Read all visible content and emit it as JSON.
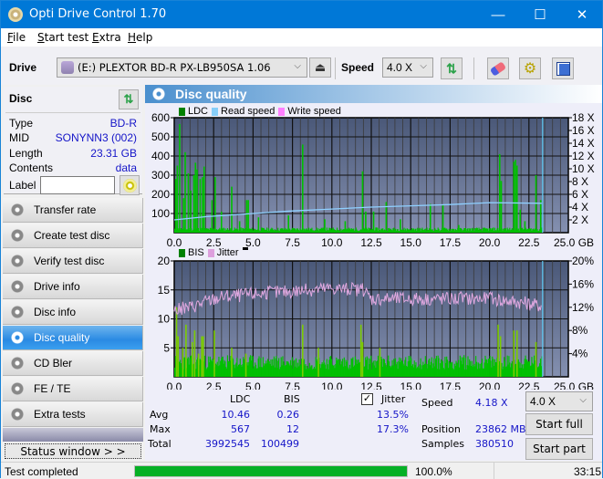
{
  "window": {
    "title": "Opti Drive Control 1.70",
    "controls": {
      "minimize": "—",
      "maximize": "☐",
      "close": "✕"
    }
  },
  "menu": [
    {
      "label": "File",
      "accel": "F",
      "rest": "ile"
    },
    {
      "label": "Start test",
      "accel": "S",
      "rest": "tart test"
    },
    {
      "label": "Extra",
      "accel": "E",
      "rest": "xtra"
    },
    {
      "label": "Help",
      "accel": "H",
      "rest": "elp"
    }
  ],
  "toolbar": {
    "drive_label": "Drive",
    "drive_value": "(E:)  PLEXTOR BD-R  PX-LB950SA 1.06",
    "speed_label": "Speed",
    "speed_value": "4.0 X",
    "icons": [
      "drive-icon",
      "eject-icon",
      "refresh-icon",
      "erase-icon",
      "settings-icon",
      "save-icon"
    ]
  },
  "disc": {
    "header": "Disc",
    "rows": [
      {
        "key": "Type",
        "value": "BD-R"
      },
      {
        "key": "MID",
        "value": "SONYNN3 (002)"
      },
      {
        "key": "Length",
        "value": "23.31 GB"
      },
      {
        "key": "Contents",
        "value": "data"
      }
    ],
    "label_key": "Label",
    "label_value": ""
  },
  "nav": [
    {
      "label": "Transfer rate",
      "active": false
    },
    {
      "label": "Create test disc",
      "active": false
    },
    {
      "label": "Verify test disc",
      "active": false
    },
    {
      "label": "Drive info",
      "active": false
    },
    {
      "label": "Disc info",
      "active": false
    },
    {
      "label": "Disc quality",
      "active": true
    },
    {
      "label": "CD Bler",
      "active": false
    },
    {
      "label": "FE / TE",
      "active": false
    },
    {
      "label": "Extra tests",
      "active": false
    }
  ],
  "status_window_label": "Status window > >",
  "panel": {
    "title": "Disc quality",
    "legend_top": [
      {
        "label": "LDC",
        "color": "#008000"
      },
      {
        "label": "Read speed",
        "color": "#87cefa"
      },
      {
        "label": "Write speed",
        "color": "#ff80ff"
      }
    ],
    "legend_bottom": [
      {
        "label": "BIS",
        "color": "#008000"
      },
      {
        "label": "Jitter",
        "color": "#dda0dd"
      }
    ]
  },
  "chart_data": [
    {
      "type": "bar",
      "title": "LDC / Read speed",
      "xlabel": "GB",
      "xlim": [
        0,
        25
      ],
      "ylim_left": [
        0,
        600
      ],
      "ylim_right": [
        0,
        18
      ],
      "x_ticks": [
        "0.0",
        "2.5",
        "5.0",
        "7.5",
        "10.0",
        "12.5",
        "15.0",
        "17.5",
        "20.0",
        "22.5",
        "25.0 GB"
      ],
      "y_left_ticks": [
        "100",
        "200",
        "300",
        "400",
        "500",
        "600"
      ],
      "y_right_ticks": [
        "2 X",
        "4 X",
        "6 X",
        "8 X",
        "10 X",
        "12 X",
        "14 X",
        "16 X",
        "18 X"
      ],
      "grid": true,
      "data_end_gb": 23.31,
      "ldc_spikes": [
        [
          0.05,
          280
        ],
        [
          0.15,
          350
        ],
        [
          0.3,
          567
        ],
        [
          0.55,
          180
        ],
        [
          0.65,
          420
        ],
        [
          0.85,
          310
        ],
        [
          1.0,
          220
        ],
        [
          1.2,
          300
        ],
        [
          1.3,
          365
        ],
        [
          1.4,
          330
        ],
        [
          1.6,
          280
        ],
        [
          1.75,
          290
        ],
        [
          1.85,
          345
        ],
        [
          2.35,
          170
        ],
        [
          2.55,
          290
        ],
        [
          2.95,
          110
        ],
        [
          3.6,
          240
        ],
        [
          4.1,
          60
        ],
        [
          4.55,
          170
        ],
        [
          4.65,
          170
        ],
        [
          5.3,
          80
        ],
        [
          7.2,
          90
        ],
        [
          8.1,
          460
        ],
        [
          9.5,
          70
        ],
        [
          10.8,
          60
        ],
        [
          11.9,
          320
        ],
        [
          12.1,
          110
        ],
        [
          12.6,
          110
        ],
        [
          13.4,
          160
        ],
        [
          14.3,
          70
        ],
        [
          16.2,
          150
        ],
        [
          17.0,
          145
        ],
        [
          18.0,
          40
        ],
        [
          20.6,
          410
        ],
        [
          20.7,
          270
        ],
        [
          21.5,
          370
        ],
        [
          21.6,
          380
        ],
        [
          21.7,
          350
        ],
        [
          21.9,
          120
        ],
        [
          22.2,
          60
        ],
        [
          22.9,
          300
        ],
        [
          23.2,
          170
        ]
      ],
      "ldc_baseline": 18,
      "read_speed": [
        [
          0,
          2.0
        ],
        [
          2,
          2.5
        ],
        [
          5,
          3.0
        ],
        [
          7.5,
          3.4
        ],
        [
          10,
          3.7
        ],
        [
          12.5,
          4.0
        ],
        [
          15,
          4.2
        ],
        [
          17.5,
          4.4
        ],
        [
          20,
          4.7
        ],
        [
          23.31,
          4.6
        ]
      ]
    },
    {
      "type": "bar",
      "title": "BIS / Jitter",
      "xlabel": "GB",
      "xlim": [
        0,
        25
      ],
      "ylim_left": [
        0,
        20
      ],
      "ylim_right": [
        0,
        20
      ],
      "x_ticks": [
        "0.0",
        "2.5",
        "5.0",
        "7.5",
        "10.0",
        "12.5",
        "15.0",
        "17.5",
        "20.0",
        "22.5",
        "25.0 GB"
      ],
      "y_left_ticks": [
        "5",
        "10",
        "15",
        "20"
      ],
      "y_right_ticks": [
        "4%",
        "8%",
        "12%",
        "16%",
        "20%"
      ],
      "grid": true,
      "data_end_gb": 23.31,
      "bis_spikes": [
        [
          0.1,
          12
        ],
        [
          0.2,
          7
        ],
        [
          0.5,
          5
        ],
        [
          0.7,
          9
        ],
        [
          1.1,
          6
        ],
        [
          1.25,
          8
        ],
        [
          1.5,
          4
        ],
        [
          1.7,
          7
        ],
        [
          1.8,
          7
        ],
        [
          2.5,
          8
        ],
        [
          3.6,
          5
        ],
        [
          4.5,
          4
        ],
        [
          8.1,
          9
        ],
        [
          9.1,
          5
        ],
        [
          11.8,
          9
        ],
        [
          11.9,
          6
        ],
        [
          13.0,
          5
        ],
        [
          20.5,
          9
        ],
        [
          20.65,
          7
        ],
        [
          21.5,
          8
        ],
        [
          21.7,
          8
        ],
        [
          22.9,
          6
        ]
      ],
      "bis_baseline": 2.5,
      "jitter_pct": [
        [
          0,
          11.5
        ],
        [
          1,
          12.0
        ],
        [
          2,
          13.0
        ],
        [
          3,
          13.8
        ],
        [
          5,
          14.3
        ],
        [
          7.5,
          14.8
        ],
        [
          10,
          15.3
        ],
        [
          12,
          15.0
        ],
        [
          12.5,
          13.5
        ],
        [
          15,
          13.5
        ],
        [
          17.5,
          13.5
        ],
        [
          20,
          13.5
        ],
        [
          22,
          12.8
        ],
        [
          23.31,
          12.2
        ]
      ]
    }
  ],
  "stats": {
    "col_ldc": "LDC",
    "col_bis": "BIS",
    "jitter_label": "Jitter",
    "jitter_checked": true,
    "rows": [
      {
        "label": "Avg",
        "ldc": "10.46",
        "bis": "0.26",
        "jitter": "13.5%"
      },
      {
        "label": "Max",
        "ldc": "567",
        "bis": "12",
        "jitter": "17.3%"
      },
      {
        "label": "Total",
        "ldc": "3992545",
        "bis": "100499",
        "jitter": ""
      }
    ],
    "speed_label": "Speed",
    "speed_value": "4.18 X",
    "position_label": "Position",
    "position_value": "23862 MB",
    "samples_label": "Samples",
    "samples_value": "380510",
    "speed_select": "4.0 X",
    "start_full": "Start full",
    "start_part": "Start part"
  },
  "statusbar": {
    "text": "Test completed",
    "progress": 1.0,
    "progress_text": "100.0%",
    "time": "33:15"
  }
}
